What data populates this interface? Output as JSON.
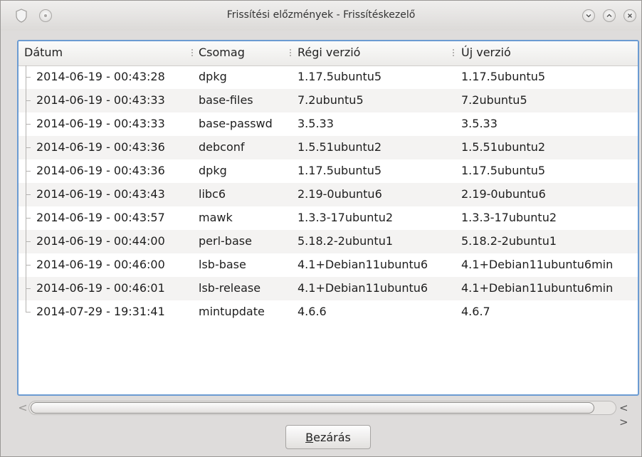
{
  "window": {
    "title": "Frissítési előzmények - Frissítéskezelő",
    "controls": [
      "minimize-icon",
      "maximize-icon",
      "close-icon"
    ],
    "app_icon": "shield-icon",
    "menu_icon": "circle-menu-icon"
  },
  "table": {
    "headers": [
      "Dátum",
      "Csomag",
      "Régi verzió",
      "Új verzió"
    ],
    "rows": [
      {
        "date": "2014-06-19 - 00:43:28",
        "package": "dpkg",
        "old": "1.17.5ubuntu5",
        "new": "1.17.5ubuntu5"
      },
      {
        "date": "2014-06-19 - 00:43:33",
        "package": "base-files",
        "old": "7.2ubuntu5",
        "new": "7.2ubuntu5"
      },
      {
        "date": "2014-06-19 - 00:43:33",
        "package": "base-passwd",
        "old": "3.5.33",
        "new": "3.5.33"
      },
      {
        "date": "2014-06-19 - 00:43:36",
        "package": "debconf",
        "old": "1.5.51ubuntu2",
        "new": "1.5.51ubuntu2"
      },
      {
        "date": "2014-06-19 - 00:43:36",
        "package": "dpkg",
        "old": "1.17.5ubuntu5",
        "new": "1.17.5ubuntu5"
      },
      {
        "date": "2014-06-19 - 00:43:43",
        "package": "libc6",
        "old": "2.19-0ubuntu6",
        "new": "2.19-0ubuntu6"
      },
      {
        "date": "2014-06-19 - 00:43:57",
        "package": "mawk",
        "old": "1.3.3-17ubuntu2",
        "new": "1.3.3-17ubuntu2"
      },
      {
        "date": "2014-06-19 - 00:44:00",
        "package": "perl-base",
        "old": "5.18.2-2ubuntu1",
        "new": "5.18.2-2ubuntu1"
      },
      {
        "date": "2014-06-19 - 00:46:00",
        "package": "lsb-base",
        "old": "4.1+Debian11ubuntu6",
        "new": "4.1+Debian11ubuntu6min"
      },
      {
        "date": "2014-06-19 - 00:46:01",
        "package": "lsb-release",
        "old": "4.1+Debian11ubuntu6",
        "new": "4.1+Debian11ubuntu6min"
      },
      {
        "date": "2014-07-29 - 19:31:41",
        "package": "mintupdate",
        "old": "4.6.6",
        "new": "4.6.7"
      }
    ]
  },
  "scrollbar": {
    "left_arrow": "<",
    "right_arrows": "< >"
  },
  "buttons": {
    "close_mnemonic": "B",
    "close_rest": "ezárás"
  }
}
